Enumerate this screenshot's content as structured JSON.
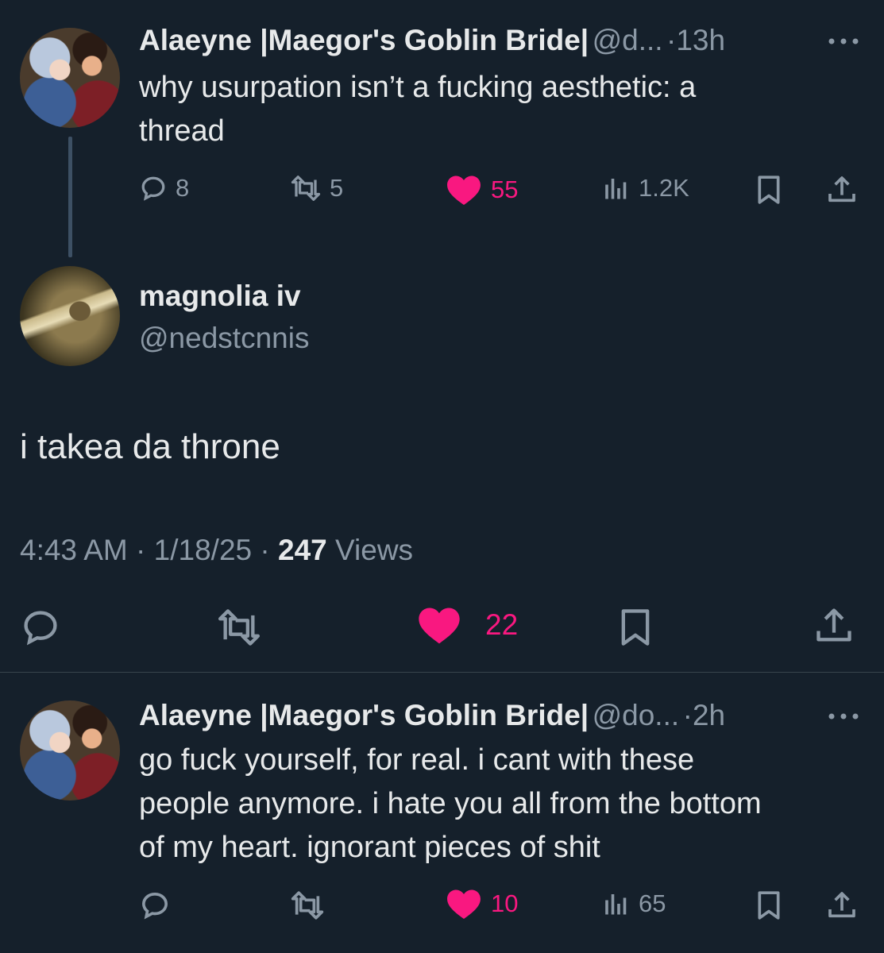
{
  "tweets": [
    {
      "name": "Alaeyne |Maegor's Goblin Bride|",
      "handle": "@d...",
      "sep": "·",
      "time": "13h",
      "text_line1": "why usurpation isn’t a fucking aesthetic: a",
      "text_line2": "thread",
      "replies": "8",
      "retweets": "5",
      "likes": "55",
      "views": "1.2K"
    },
    {
      "name": "Alaeyne |Maegor's Goblin Bride|",
      "handle": "@do...",
      "sep": "·",
      "time": "2h",
      "text_line1": "go fuck yourself, for real. i cant with these",
      "text_line2": "people anymore. i hate you all from the bottom",
      "text_line3": "of my heart. ignorant pieces of shit",
      "likes": "10",
      "views": "65"
    }
  ],
  "focused": {
    "name": "magnolia iv",
    "handle": "@nedstcnnis",
    "text": "i takea da throne",
    "time": "4:43 AM",
    "sep1": "·",
    "date": "1/18/25",
    "sep2": "·",
    "views_count": "247",
    "views_label": "Views",
    "likes": "22"
  },
  "colors": {
    "background": "#15202b",
    "like_pink": "#f91880",
    "muted": "#8b98a5"
  }
}
